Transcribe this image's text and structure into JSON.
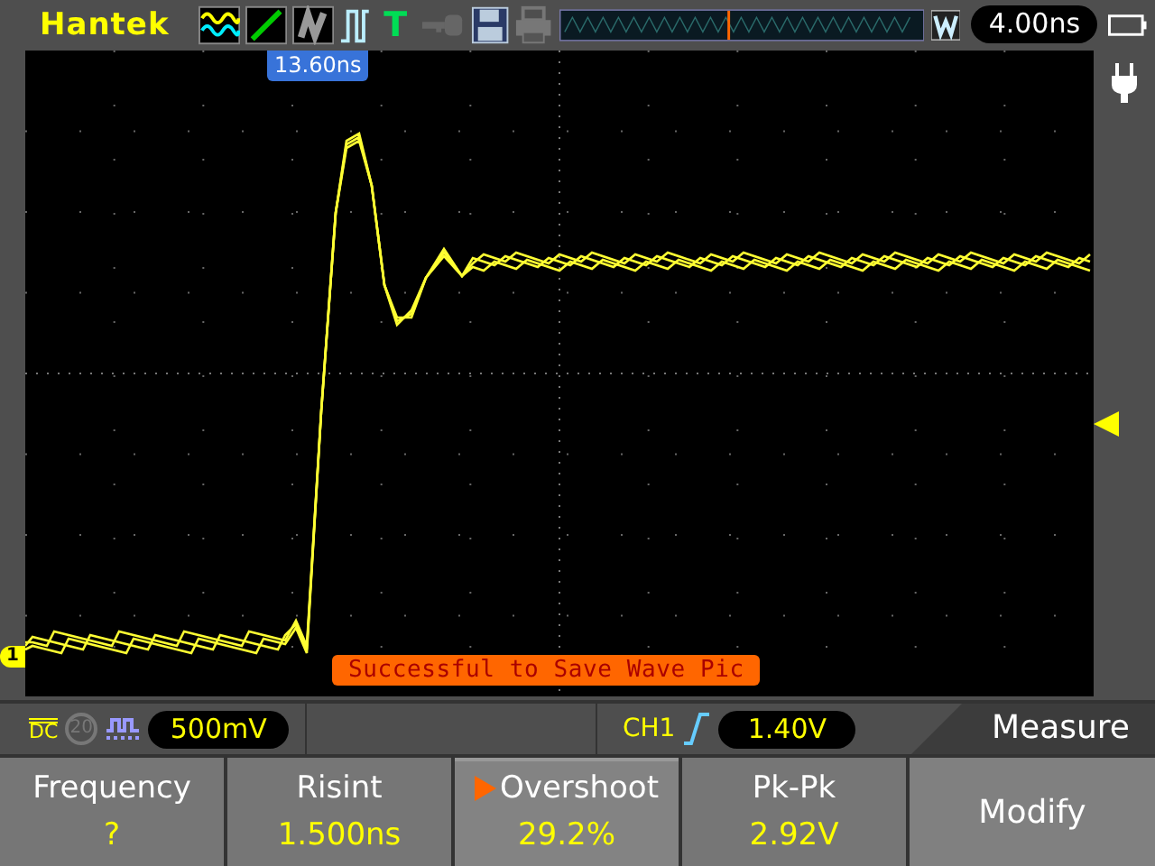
{
  "header": {
    "brand": "Hantek",
    "trigger_mode_label": "T",
    "timebase": "4.00ns"
  },
  "screen": {
    "trigger_time": "13.60ns",
    "channel_marker": "1",
    "message": "Successful to Save Wave Pic"
  },
  "channel_bar": {
    "coupling": "DC",
    "bandwidth_limit": {
      "label": "20",
      "on": false
    },
    "volts_div": "500mV"
  },
  "trigger_bar": {
    "source": "CH1",
    "level": "1.40V"
  },
  "menu": {
    "title": "Measure",
    "items": [
      {
        "label": "Frequency",
        "value": "?",
        "selected": false
      },
      {
        "label": "Risint",
        "value": "1.500ns",
        "selected": false
      },
      {
        "label": "Overshoot",
        "value": "29.2%",
        "selected": true
      },
      {
        "label": "Pk-Pk",
        "value": "2.92V",
        "selected": false
      }
    ],
    "button": "Modify"
  }
}
